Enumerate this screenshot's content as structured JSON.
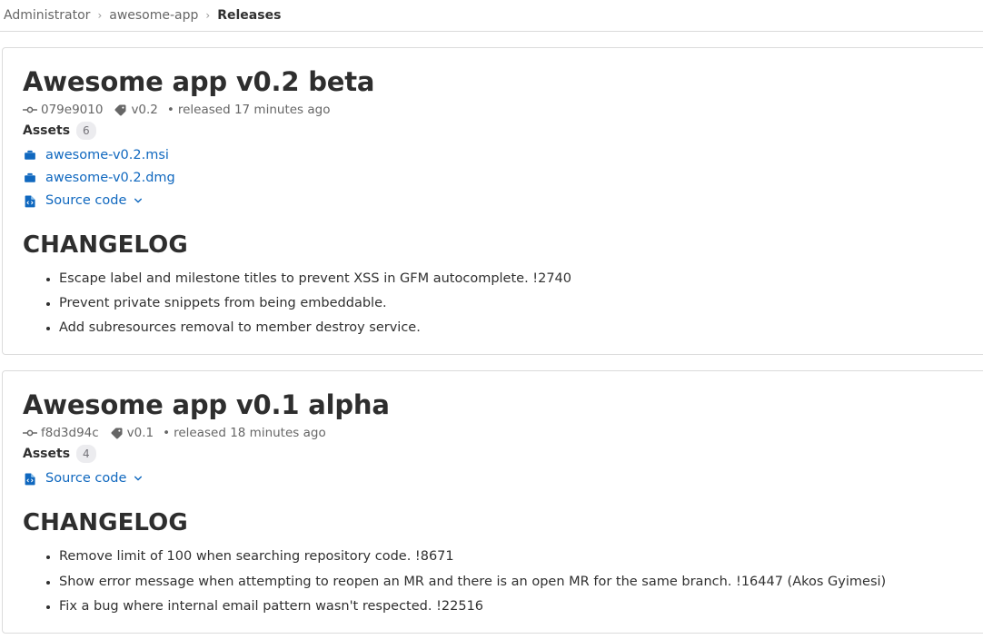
{
  "breadcrumb": {
    "items": [
      {
        "label": "Administrator",
        "current": false
      },
      {
        "label": "awesome-app",
        "current": false
      },
      {
        "label": "Releases",
        "current": true
      }
    ],
    "separator": "›"
  },
  "colors": {
    "link": "#1068bf",
    "heading": "#2e2e2e",
    "muted": "#666666",
    "border": "#dbdbdb",
    "badge_bg": "#ececef",
    "badge_text": "#737278"
  },
  "releases": [
    {
      "title": "Awesome app v0.2 beta",
      "commit": "079e9010",
      "commit_icon": "commit-icon",
      "tag": "v0.2",
      "tag_icon": "tag-icon",
      "released_dot": "•",
      "released": "released 17 minutes ago",
      "assets_label": "Assets",
      "assets_count": "6",
      "assets": [
        {
          "label": "awesome-v0.2.msi",
          "icon": "package-icon",
          "has_chevron": false
        },
        {
          "label": "awesome-v0.2.dmg",
          "icon": "package-icon",
          "has_chevron": false
        },
        {
          "label": "Source code",
          "icon": "source-code-file-icon",
          "has_chevron": true
        }
      ],
      "changelog_title": "CHANGELOG",
      "changelog": [
        "Escape label and milestone titles to prevent XSS in GFM autocomplete. !2740",
        "Prevent private snippets from being embeddable.",
        "Add subresources removal to member destroy service."
      ]
    },
    {
      "title": "Awesome app v0.1 alpha",
      "commit": "f8d3d94c",
      "commit_icon": "commit-icon",
      "tag": "v0.1",
      "tag_icon": "tag-icon",
      "released_dot": "•",
      "released": "released 18 minutes ago",
      "assets_label": "Assets",
      "assets_count": "4",
      "assets": [
        {
          "label": "Source code",
          "icon": "source-code-file-icon",
          "has_chevron": true
        }
      ],
      "changelog_title": "CHANGELOG",
      "changelog": [
        "Remove limit of 100 when searching repository code. !8671",
        "Show error message when attempting to reopen an MR and there is an open MR for the same branch. !16447 (Akos Gyimesi)",
        "Fix a bug where internal email pattern wasn't respected. !22516"
      ]
    }
  ]
}
